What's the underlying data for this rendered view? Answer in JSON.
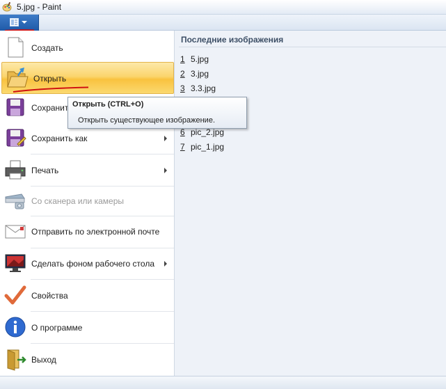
{
  "window": {
    "title": "5.jpg - Paint"
  },
  "app_menu_button": {
    "icon": "document-menu-icon"
  },
  "menu": {
    "items": [
      {
        "label": "Создать",
        "icon": "new-file-icon"
      },
      {
        "label": "Открыть",
        "icon": "open-folder-icon"
      },
      {
        "label": "Сохранить",
        "icon": "save-disk-icon"
      },
      {
        "label": "Сохранить как",
        "icon": "save-as-icon"
      },
      {
        "label": "Печать",
        "icon": "printer-icon"
      },
      {
        "label": "Со сканера или камеры",
        "icon": "scanner-icon"
      },
      {
        "label": "Отправить по электронной почте",
        "icon": "email-icon"
      },
      {
        "label": "Сделать фоном рабочего стола",
        "icon": "desktop-background-icon"
      },
      {
        "label": "Свойства",
        "icon": "properties-check-icon"
      },
      {
        "label": "О программе",
        "icon": "info-icon"
      },
      {
        "label": "Выход",
        "icon": "exit-icon"
      }
    ]
  },
  "tooltip": {
    "title": "Открыть (CTRL+O)",
    "description": "Открыть существующее изображение."
  },
  "recent": {
    "title": "Последние изображения",
    "items": [
      {
        "num": "1",
        "name": "5.jpg"
      },
      {
        "num": "2",
        "name": "3.jpg"
      },
      {
        "num": "3",
        "name": "3.3.jpg"
      },
      {
        "num": "6",
        "name": "pic_2.jpg"
      },
      {
        "num": "7",
        "name": "pic_1.jpg"
      }
    ]
  },
  "colors": {
    "highlight": "#fbd56d",
    "accent": "#1f5aa8",
    "annotation": "#d01010"
  }
}
